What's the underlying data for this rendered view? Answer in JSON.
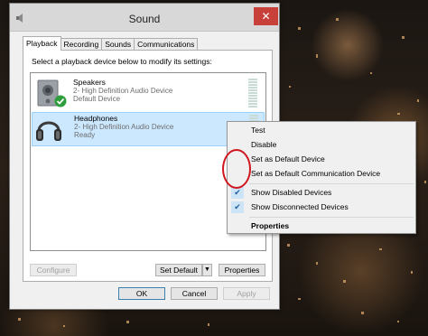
{
  "window": {
    "title": "Sound",
    "close_glyph": "✕",
    "app_icon": "speaker-icon"
  },
  "tabs": [
    {
      "label": "Playback",
      "active": true
    },
    {
      "label": "Recording",
      "active": false
    },
    {
      "label": "Sounds",
      "active": false
    },
    {
      "label": "Communications",
      "active": false
    }
  ],
  "panel": {
    "instructions": "Select a playback device below to modify its settings:"
  },
  "devices": [
    {
      "name": "Speakers",
      "description": "2- High Definition Audio Device",
      "status": "Default Device",
      "icon": "speaker-device-icon",
      "default_check": true,
      "selected": false
    },
    {
      "name": "Headphones",
      "description": "2- High Definition Audio Device",
      "status": "Ready",
      "icon": "headphones-icon",
      "default_check": false,
      "selected": true
    }
  ],
  "panel_buttons": {
    "configure": "Configure",
    "set_default": "Set Default",
    "set_default_arrow": "▼",
    "properties": "Properties"
  },
  "dialog_buttons": {
    "ok": "OK",
    "cancel": "Cancel",
    "apply": "Apply"
  },
  "context_menu": {
    "items": [
      {
        "label": "Test",
        "checked": false,
        "bold": false
      },
      {
        "label": "Disable",
        "checked": false,
        "bold": false
      },
      {
        "label": "Set as Default Device",
        "checked": false,
        "bold": false
      },
      {
        "label": "Set as Default Communication Device",
        "checked": false,
        "bold": false
      },
      {
        "label": "Show Disabled Devices",
        "checked": true,
        "bold": false
      },
      {
        "label": "Show Disconnected Devices",
        "checked": true,
        "bold": false
      },
      {
        "label": "Properties",
        "checked": false,
        "bold": true
      }
    ],
    "check_glyph": "✔"
  },
  "colors": {
    "selection": "#cce8ff",
    "close_button": "#c7403a",
    "annotation": "#d0161e",
    "default_badge": "#2e9e3c"
  }
}
